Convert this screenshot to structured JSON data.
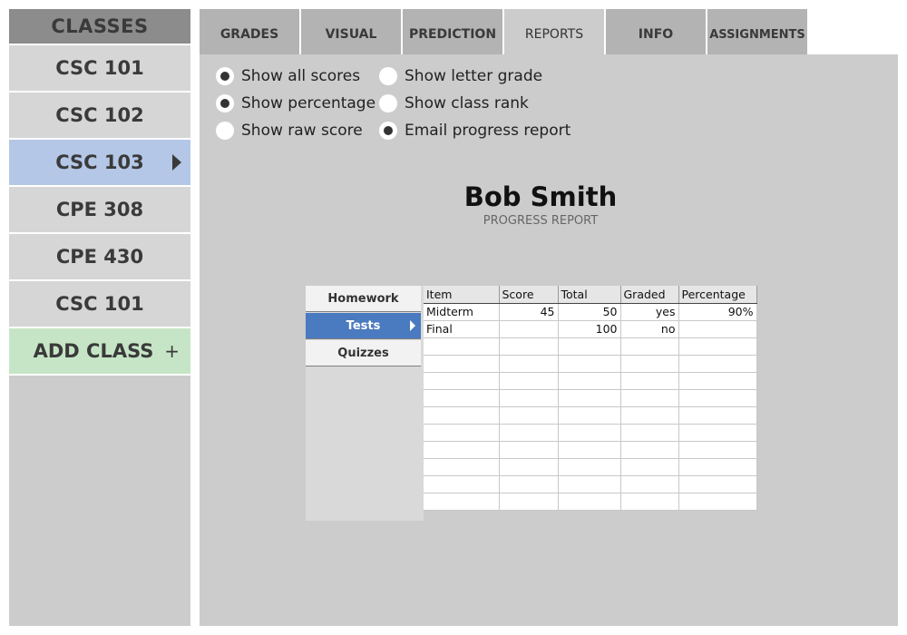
{
  "sidebar": {
    "header": "CLASSES",
    "classes": [
      {
        "label": "CSC 101",
        "active": false
      },
      {
        "label": "CSC 102",
        "active": false
      },
      {
        "label": "CSC 103",
        "active": true
      },
      {
        "label": "CPE 308",
        "active": false
      },
      {
        "label": "CPE 430",
        "active": false
      },
      {
        "label": "CSC 101",
        "active": false
      }
    ],
    "add_class": {
      "label": "ADD CLASS",
      "icon": "+"
    }
  },
  "tabs": [
    "GRADES",
    "VISUAL",
    "PREDICTION",
    "REPORTS",
    "INFO",
    "ASSIGNMENTS"
  ],
  "active_tab": "REPORTS",
  "options": [
    {
      "label": "Show all scores",
      "checked": true
    },
    {
      "label": "Show percentage",
      "checked": true
    },
    {
      "label": "Show raw score",
      "checked": false
    },
    {
      "label": "Show letter grade",
      "checked": false
    },
    {
      "label": "Show class rank",
      "checked": false
    },
    {
      "label": "Email progress report",
      "checked": true
    }
  ],
  "report": {
    "student_name": "Bob Smith",
    "subtitle": "PROGRESS REPORT"
  },
  "categories": [
    {
      "label": "Homework",
      "active": false
    },
    {
      "label": "Tests",
      "active": true
    },
    {
      "label": "Quizzes",
      "active": false
    }
  ],
  "table": {
    "columns": [
      "Item",
      "Score",
      "Total",
      "Graded",
      "Percentage"
    ],
    "rows": [
      [
        "Midterm",
        "45",
        "50",
        "yes",
        "90%"
      ],
      [
        "Final",
        "",
        "100",
        "no",
        ""
      ]
    ],
    "empty_rows": 10
  },
  "colors": {
    "active_class": "#b4c7e7",
    "add_class": "#c6e5c6",
    "active_category": "#4a7ac0"
  }
}
